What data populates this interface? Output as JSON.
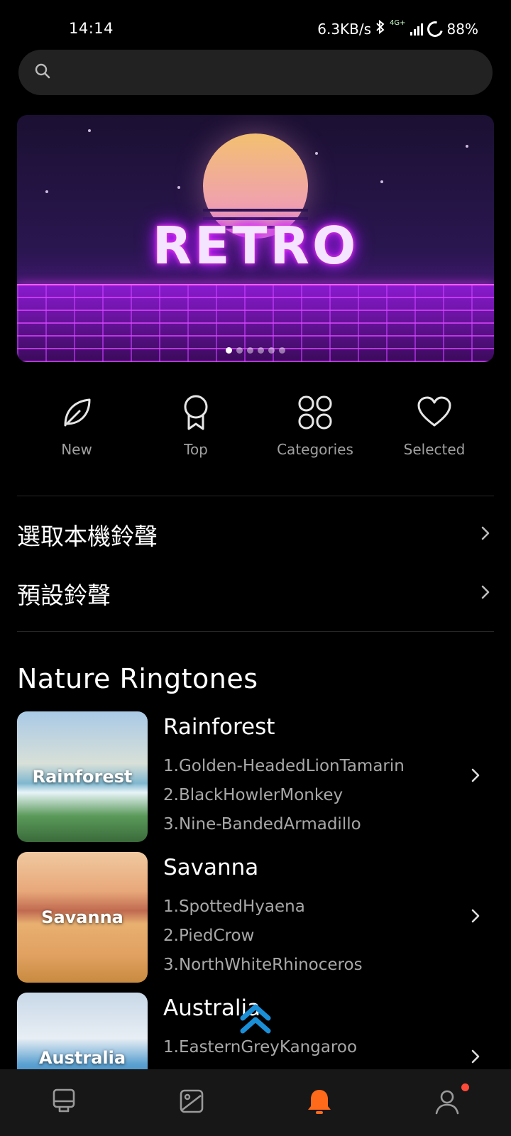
{
  "status_bar": {
    "time": "14:14",
    "net_speed": "6.3KB/s",
    "network_type": "4G+",
    "battery": "88%"
  },
  "search": {
    "placeholder": "",
    "icon": "search-icon"
  },
  "banner": {
    "title": "RETRO",
    "slide_count": 6,
    "active_slide": 1
  },
  "quick_nav": [
    {
      "label": "New",
      "icon": "leaf-icon"
    },
    {
      "label": "Top",
      "icon": "award-icon"
    },
    {
      "label": "Categories",
      "icon": "categories-icon"
    },
    {
      "label": "Selected",
      "icon": "heart-icon"
    }
  ],
  "settings_rows": [
    {
      "label": "選取本機鈴聲"
    },
    {
      "label": "預設鈴聲"
    }
  ],
  "section": {
    "title": "Nature Ringtones"
  },
  "cards": [
    {
      "title": "Rainforest",
      "thumb_label": "Rainforest",
      "tracks": [
        "1.Golden-HeadedLionTamarin",
        "2.BlackHowlerMonkey",
        "3.Nine-BandedArmadillo"
      ]
    },
    {
      "title": "Savanna",
      "thumb_label": "Savanna",
      "tracks": [
        "1.SpottedHyaena",
        "2.PiedCrow",
        "3.NorthWhiteRhinoceros"
      ]
    },
    {
      "title": "Australia",
      "thumb_label": "Australia",
      "tracks": [
        "1.EasternGreyKangaroo"
      ]
    }
  ],
  "bottom_nav": [
    {
      "icon": "kiosk-icon",
      "active": false
    },
    {
      "icon": "wallpaper-icon",
      "active": false
    },
    {
      "icon": "bell-icon",
      "active": true
    },
    {
      "icon": "profile-icon",
      "active": false,
      "badge": true
    }
  ],
  "colors": {
    "background": "#000000",
    "accent": "#ff6a1a",
    "secondary_text": "#a8a8a8",
    "scroll_top": "#1a8fd8"
  }
}
